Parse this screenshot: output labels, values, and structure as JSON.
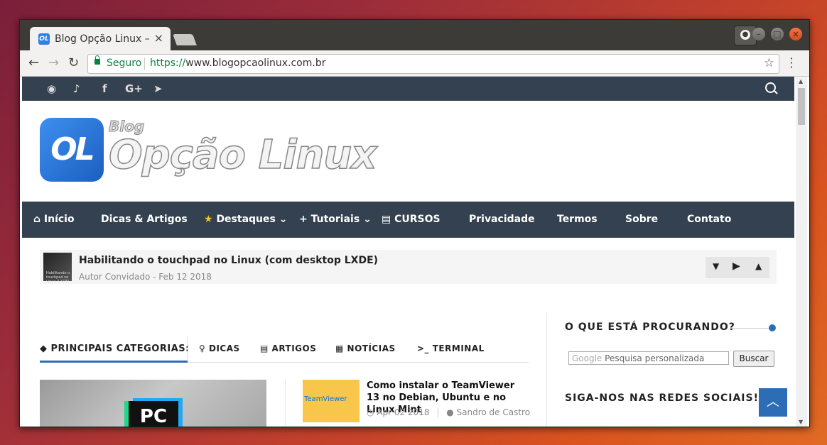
{
  "browser": {
    "tab_title": "Blog Opção Linux –",
    "tab_favicon": "OL",
    "secure_label": "Seguro",
    "url_scheme": "https://",
    "url_rest": "www.blogopcaolinux.com.br"
  },
  "site": {
    "logo_mark": "OL",
    "logo_blog": "Blog",
    "logo_name": "Opção Linux",
    "social_icons": [
      "rss-icon",
      "twitter-icon",
      "facebook-icon",
      "google-plus-icon",
      "telegram-icon"
    ]
  },
  "nav": {
    "inicio": "Início",
    "dicas": "Dicas & Artigos",
    "destaques": "Destaques",
    "tutoriais": "+ Tutoriais",
    "cursos": "CURSOS",
    "privacidade": "Privacidade",
    "termos": "Termos",
    "sobre": "Sobre",
    "contato": "Contato"
  },
  "ticker": {
    "title": "Habilitando o touchpad no Linux (com desktop LXDE)",
    "meta": "Autor Convidado - Feb 12 2018",
    "thumb_text": "Habilitando o touchpad no Linux (LXDE)"
  },
  "categories": {
    "heading": "PRINCIPAIS CATEGORIAS:",
    "tabs": [
      "DICAS",
      "ARTIGOS",
      "NOTÍCIAS",
      "TERMINAL"
    ]
  },
  "featured": {
    "badge": "PC"
  },
  "article": {
    "thumb_text": "TeamViewer",
    "title": "Como instalar o TeamViewer 13 no Debian, Ubuntu e no Linux Mint",
    "date": "Apr 02 2018",
    "author": "Sandro de Castro"
  },
  "sidebar": {
    "search_heading": "O QUE ESTÁ PROCURANDO?",
    "search_placeholder_brand": "Google",
    "search_placeholder": "Pesquisa personalizada",
    "search_button": "Buscar",
    "social_heading": "SIGA-NOS NAS REDES SOCIAIS!"
  },
  "colors": {
    "nav_bg": "#344150",
    "accent": "#2d6db5"
  }
}
